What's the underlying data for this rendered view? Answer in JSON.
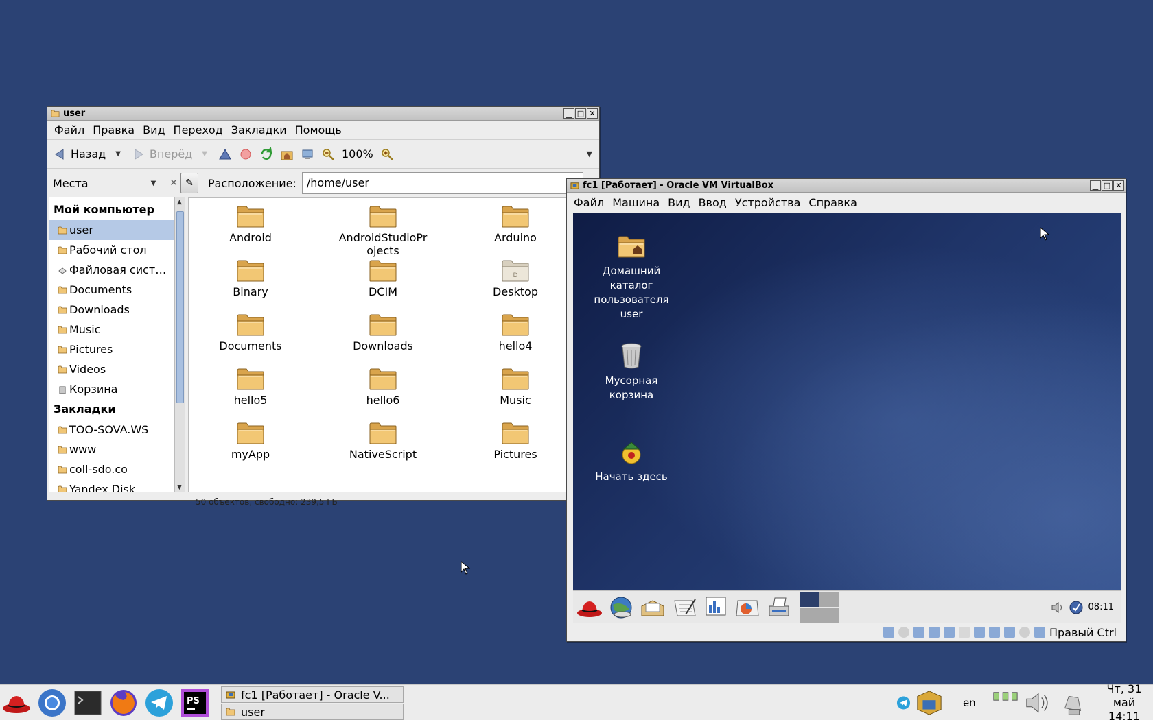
{
  "file_manager": {
    "title": "user",
    "menu": [
      "Файл",
      "Правка",
      "Вид",
      "Переход",
      "Закладки",
      "Помощь"
    ],
    "toolbar": {
      "back_label": "Назад",
      "forward_label": "Вперёд",
      "zoom_value": "100%"
    },
    "places_label": "Места",
    "location_label": "Расположение:",
    "location_value": "/home/user",
    "sidebar": {
      "section_computer": "Мой компьютер",
      "computer_items": [
        "user",
        "Рабочий стол",
        "Файловая сист…",
        "Documents",
        "Downloads",
        "Music",
        "Pictures",
        "Videos",
        "Корзина"
      ],
      "section_bookmarks": "Закладки",
      "bookmark_items": [
        "TOO-SOVA.WS",
        "www",
        "coll-sdo.co",
        "Yandex.Disk"
      ]
    },
    "files": [
      "Android",
      "AndroidStudioPr\nojects",
      "Arduino",
      "Binary",
      "DCIM",
      "Desktop",
      "Documents",
      "Downloads",
      "hello4",
      "hello5",
      "hello6",
      "Music",
      "myApp",
      "NativeScript",
      "Pictures"
    ],
    "status": "50 объектов, свободно: 239,5 ГБ"
  },
  "virtualbox": {
    "title": "fc1 [Работает] - Oracle VM VirtualBox",
    "menu": [
      "Файл",
      "Машина",
      "Вид",
      "Ввод",
      "Устройства",
      "Справка"
    ],
    "desktop_icons": [
      "Домашний каталог пользователя user",
      "Мусорная корзина",
      "Начать здесь"
    ],
    "guest_clock": "08:11",
    "host_key": "Правый Ctrl"
  },
  "taskbar": {
    "tasks": [
      "fc1 [Работает] - Oracle V...",
      "user"
    ],
    "keyboard_layout": "en",
    "date": "Чт, 31 май",
    "time": "14:11"
  },
  "colors": {
    "desktop": "#2b4274",
    "selection": "#b5c9e6",
    "folder": "#e8b85c"
  }
}
